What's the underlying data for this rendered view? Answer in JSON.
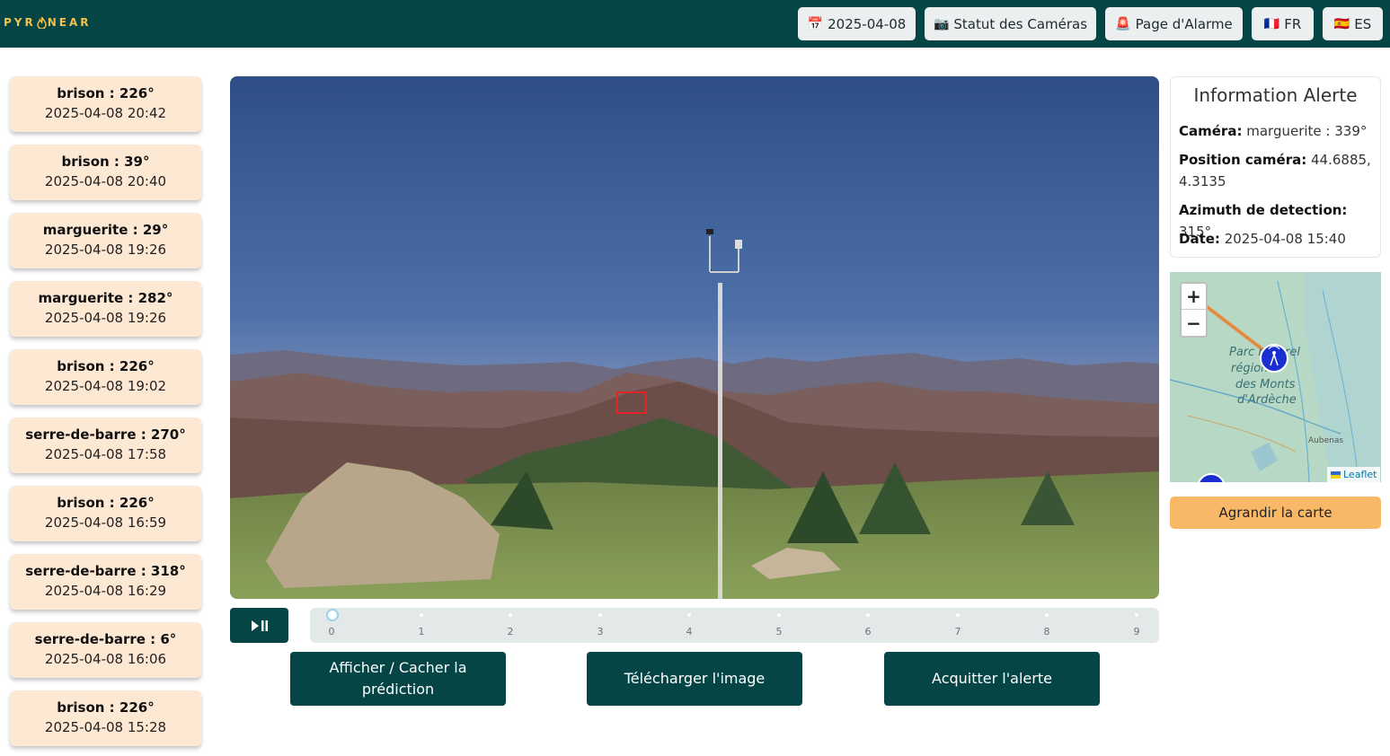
{
  "header": {
    "logo_text": "PYRONEAR",
    "nav": [
      {
        "icon": "calendar-icon",
        "glyph": "📅",
        "label": "2025-04-08"
      },
      {
        "icon": "camera-icon",
        "glyph": "📷",
        "label": "Statut des Caméras"
      },
      {
        "icon": "siren-icon",
        "glyph": "🚨",
        "label": "Page d'Alarme"
      },
      {
        "icon": "flag-fr-icon",
        "glyph": "🇫🇷",
        "label": "FR"
      },
      {
        "icon": "flag-es-icon",
        "glyph": "🇪🇸",
        "label": "ES"
      }
    ]
  },
  "alerts": [
    {
      "title": "brison : 226°",
      "time": "2025-04-08 20:42"
    },
    {
      "title": "brison : 39°",
      "time": "2025-04-08 20:40"
    },
    {
      "title": "marguerite : 29°",
      "time": "2025-04-08 19:26"
    },
    {
      "title": "marguerite : 282°",
      "time": "2025-04-08 19:26"
    },
    {
      "title": "brison : 226°",
      "time": "2025-04-08 19:02"
    },
    {
      "title": "serre-de-barre : 270°",
      "time": "2025-04-08 17:58"
    },
    {
      "title": "brison : 226°",
      "time": "2025-04-08 16:59"
    },
    {
      "title": "serre-de-barre : 318°",
      "time": "2025-04-08 16:29"
    },
    {
      "title": "serre-de-barre : 6°",
      "time": "2025-04-08 16:06"
    },
    {
      "title": "brison : 226°",
      "time": "2025-04-08 15:28"
    }
  ],
  "timeline": {
    "ticks": [
      "0",
      "1",
      "2",
      "3",
      "4",
      "5",
      "6",
      "7",
      "8",
      "9"
    ],
    "current": 0
  },
  "actions": {
    "toggle_prediction": "Afficher / Cacher la prédiction",
    "download_image": "Télécharger l'image",
    "acknowledge": "Acquitter l'alerte"
  },
  "info": {
    "title": "Information Alerte",
    "camera_label": "Caméra:",
    "camera_value": "marguerite : 339°",
    "position_label": "Position caméra:",
    "position_value": "44.6885, 4.3135",
    "azimuth_label": "Azimuth de detection:",
    "azimuth_value": "315°",
    "date_label": "Date:",
    "date_value": "2025-04-08 15:40"
  },
  "map": {
    "zoom_in": "+",
    "zoom_out": "−",
    "place_label_1": "Parc naturel",
    "place_label_2": "régional",
    "place_label_3": "des Monts",
    "place_label_4": "d'Ardèche",
    "town_label": "Aubenas",
    "attribution": "Leaflet",
    "expand_button": "Agrandir la carte"
  },
  "colors": {
    "header_bg": "#054546",
    "alert_card_bg": "#fde8d3",
    "primary_button": "#054546",
    "map_button": "#f9b868"
  }
}
